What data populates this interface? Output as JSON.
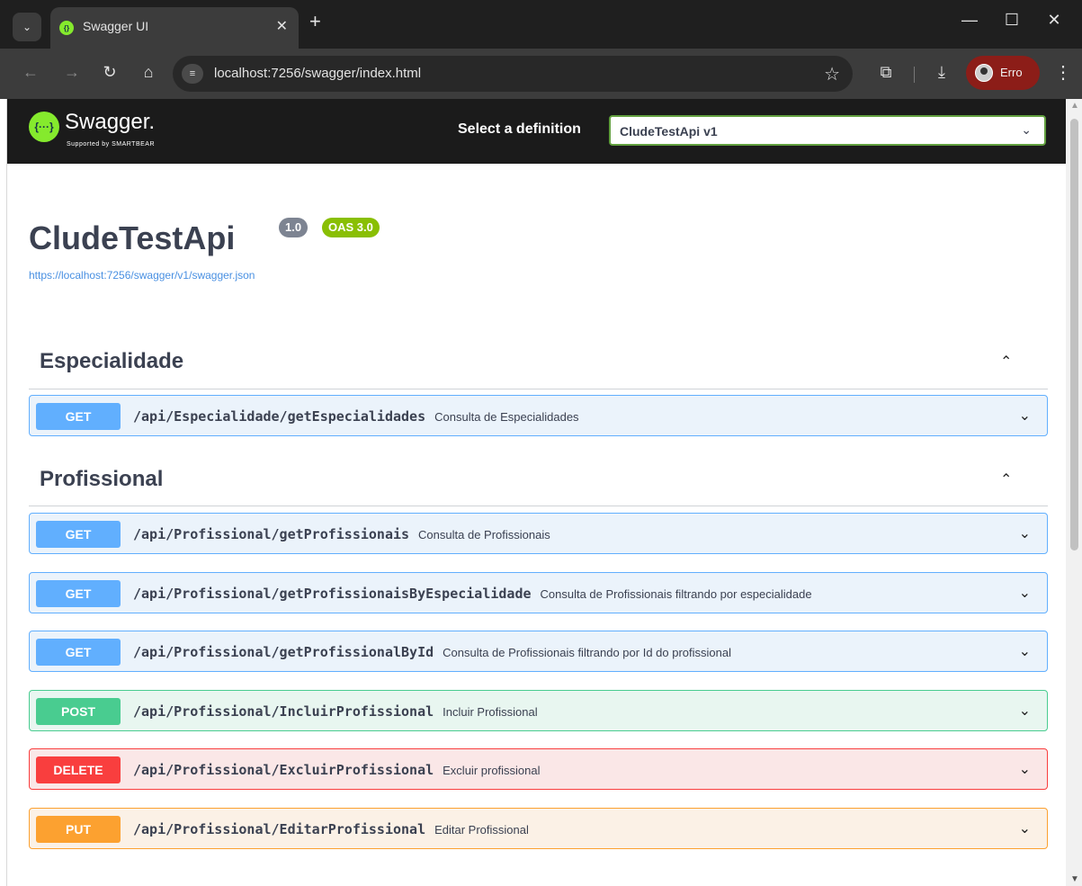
{
  "browser": {
    "tab_title": "Swagger UI",
    "url": "localhost:7256/swagger/index.html",
    "profile_label": "Erro",
    "icons": [
      "chevron-down-icon",
      "close-icon",
      "plus-icon",
      "minimize-icon",
      "maximize-icon",
      "back-icon",
      "forward-icon",
      "reload-icon",
      "home-icon",
      "site-info-icon",
      "star-icon",
      "extensions-icon",
      "download-icon",
      "menu-icon"
    ]
  },
  "swagger": {
    "logo_text": "Swagger.",
    "logo_sub": "Supported by SMARTBEAR",
    "select_label": "Select a definition",
    "selected_definition": "CludeTestApi v1"
  },
  "info": {
    "title": "CludeTestApi",
    "version": "1.0",
    "oas": "OAS 3.0",
    "spec_url": "https://localhost:7256/swagger/v1/swagger.json"
  },
  "sections": [
    {
      "name": "Especialidade",
      "operations": [
        {
          "method": "GET",
          "path": "/api/Especialidade/getEspecialidades",
          "summary": "Consulta de Especialidades"
        }
      ]
    },
    {
      "name": "Profissional",
      "operations": [
        {
          "method": "GET",
          "path": "/api/Profissional/getProfissionais",
          "summary": "Consulta de Profissionais"
        },
        {
          "method": "GET",
          "path": "/api/Profissional/getProfissionaisByEspecialidade",
          "summary": "Consulta de Profissionais filtrando por especialidade"
        },
        {
          "method": "GET",
          "path": "/api/Profissional/getProfissionalById",
          "summary": "Consulta de Profissionais filtrando por Id do profissional"
        },
        {
          "method": "POST",
          "path": "/api/Profissional/IncluirProfissional",
          "summary": "Incluir Profissional"
        },
        {
          "method": "DELETE",
          "path": "/api/Profissional/ExcluirProfissional",
          "summary": "Excluir profissional"
        },
        {
          "method": "PUT",
          "path": "/api/Profissional/EditarProfissional",
          "summary": "Editar Profissional"
        }
      ]
    }
  ],
  "colors": {
    "get": "#61affe",
    "post": "#49cc90",
    "delete": "#f93e3e",
    "put": "#fca130",
    "swagger_green": "#85ea2d",
    "oas_badge": "#89bf04",
    "version_badge": "#7d8492"
  }
}
